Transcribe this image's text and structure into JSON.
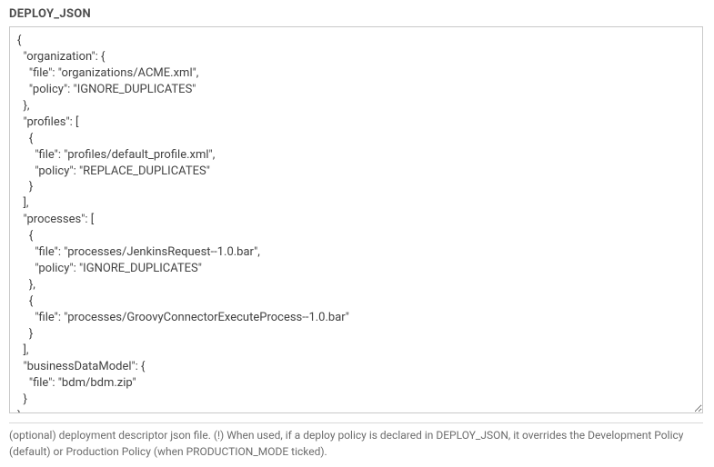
{
  "field": {
    "label": "DEPLOY_JSON",
    "value": "{\n  \"organization\": {\n    \"file\": \"organizations/ACME.xml\",\n    \"policy\": \"IGNORE_DUPLICATES\"\n  },\n  \"profiles\": [\n    {\n      \"file\": \"profiles/default_profile.xml\",\n      \"policy\": \"REPLACE_DUPLICATES\"\n    }\n  ],\n  \"processes\": [\n    {\n      \"file\": \"processes/JenkinsRequest--1.0.bar\",\n      \"policy\": \"IGNORE_DUPLICATES\"\n    },\n    {\n      \"file\": \"processes/GroovyConnectorExecuteProcess--1.0.bar\"\n    }\n  ],\n  \"businessDataModel\": {\n    \"file\": \"bdm/bdm.zip\"\n  }\n}",
    "help": "(optional) deployment descriptor json file. (!) When used, if a deploy policy is declared in DEPLOY_JSON, it overrides the Development Policy (default) or Production Policy (when PRODUCTION_MODE ticked)."
  }
}
